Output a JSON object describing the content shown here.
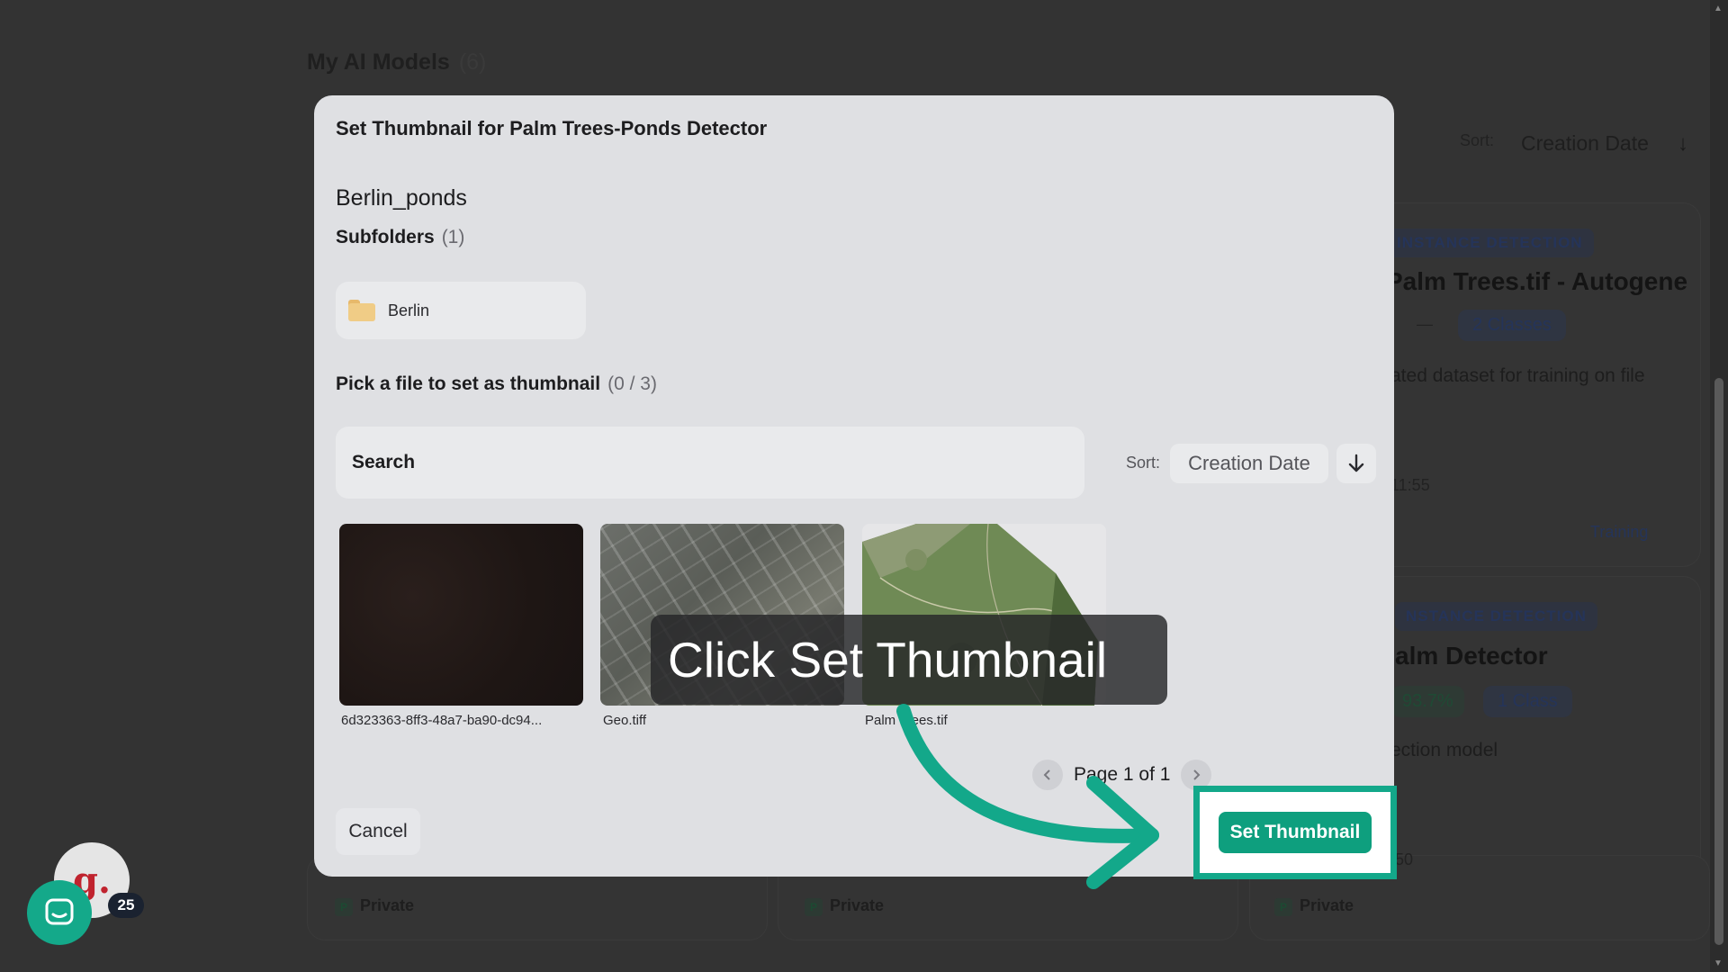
{
  "background": {
    "title": "My AI Models",
    "count": "(6)",
    "sort_label": "Sort:",
    "sort_value": "Creation Date",
    "cards": [
      {
        "tag": "INSTANCE DETECTION",
        "title": "Palm Trees.tif - Autogene",
        "classes": "2 Classes",
        "dash": "—",
        "desc": "ated dataset for training on file",
        "time": "11:55",
        "status": "Training"
      },
      {
        "tag": "NSTANCE DETECTION",
        "title": "alm Detector",
        "accuracy": "93.7%",
        "classes": "1 Class",
        "desc": "ection model",
        "time": "50"
      }
    ],
    "privacy": [
      "Private",
      "Private",
      "Private"
    ],
    "privacy_letter": "P"
  },
  "modal": {
    "title": "Set Thumbnail for Palm Trees-Ponds Detector",
    "folder_name": "Berlin_ponds",
    "subfolders_label": "Subfolders",
    "subfolders_count": "(1)",
    "subfolder_items": [
      "Berlin"
    ],
    "pick_label": "Pick a file to set as thumbnail",
    "pick_count": "(0 / 3)",
    "search_placeholder": "Search",
    "sort_label": "Sort:",
    "sort_value": "Creation Date",
    "files": [
      "6d323363-8ff3-48a7-ba90-dc94...",
      "Geo.tiff",
      "Palm Trees.tif"
    ],
    "pager_text": "Page 1 of 1",
    "cancel_label": "Cancel",
    "set_thumbnail_label": "Set Thumbnail"
  },
  "annotation": {
    "tooltip": "Click Set Thumbnail",
    "highlight_color": "#13a88a"
  },
  "widgets": {
    "avatar_letter": "g.",
    "chat_badge": "25",
    "chat_color": "#14a98a"
  }
}
